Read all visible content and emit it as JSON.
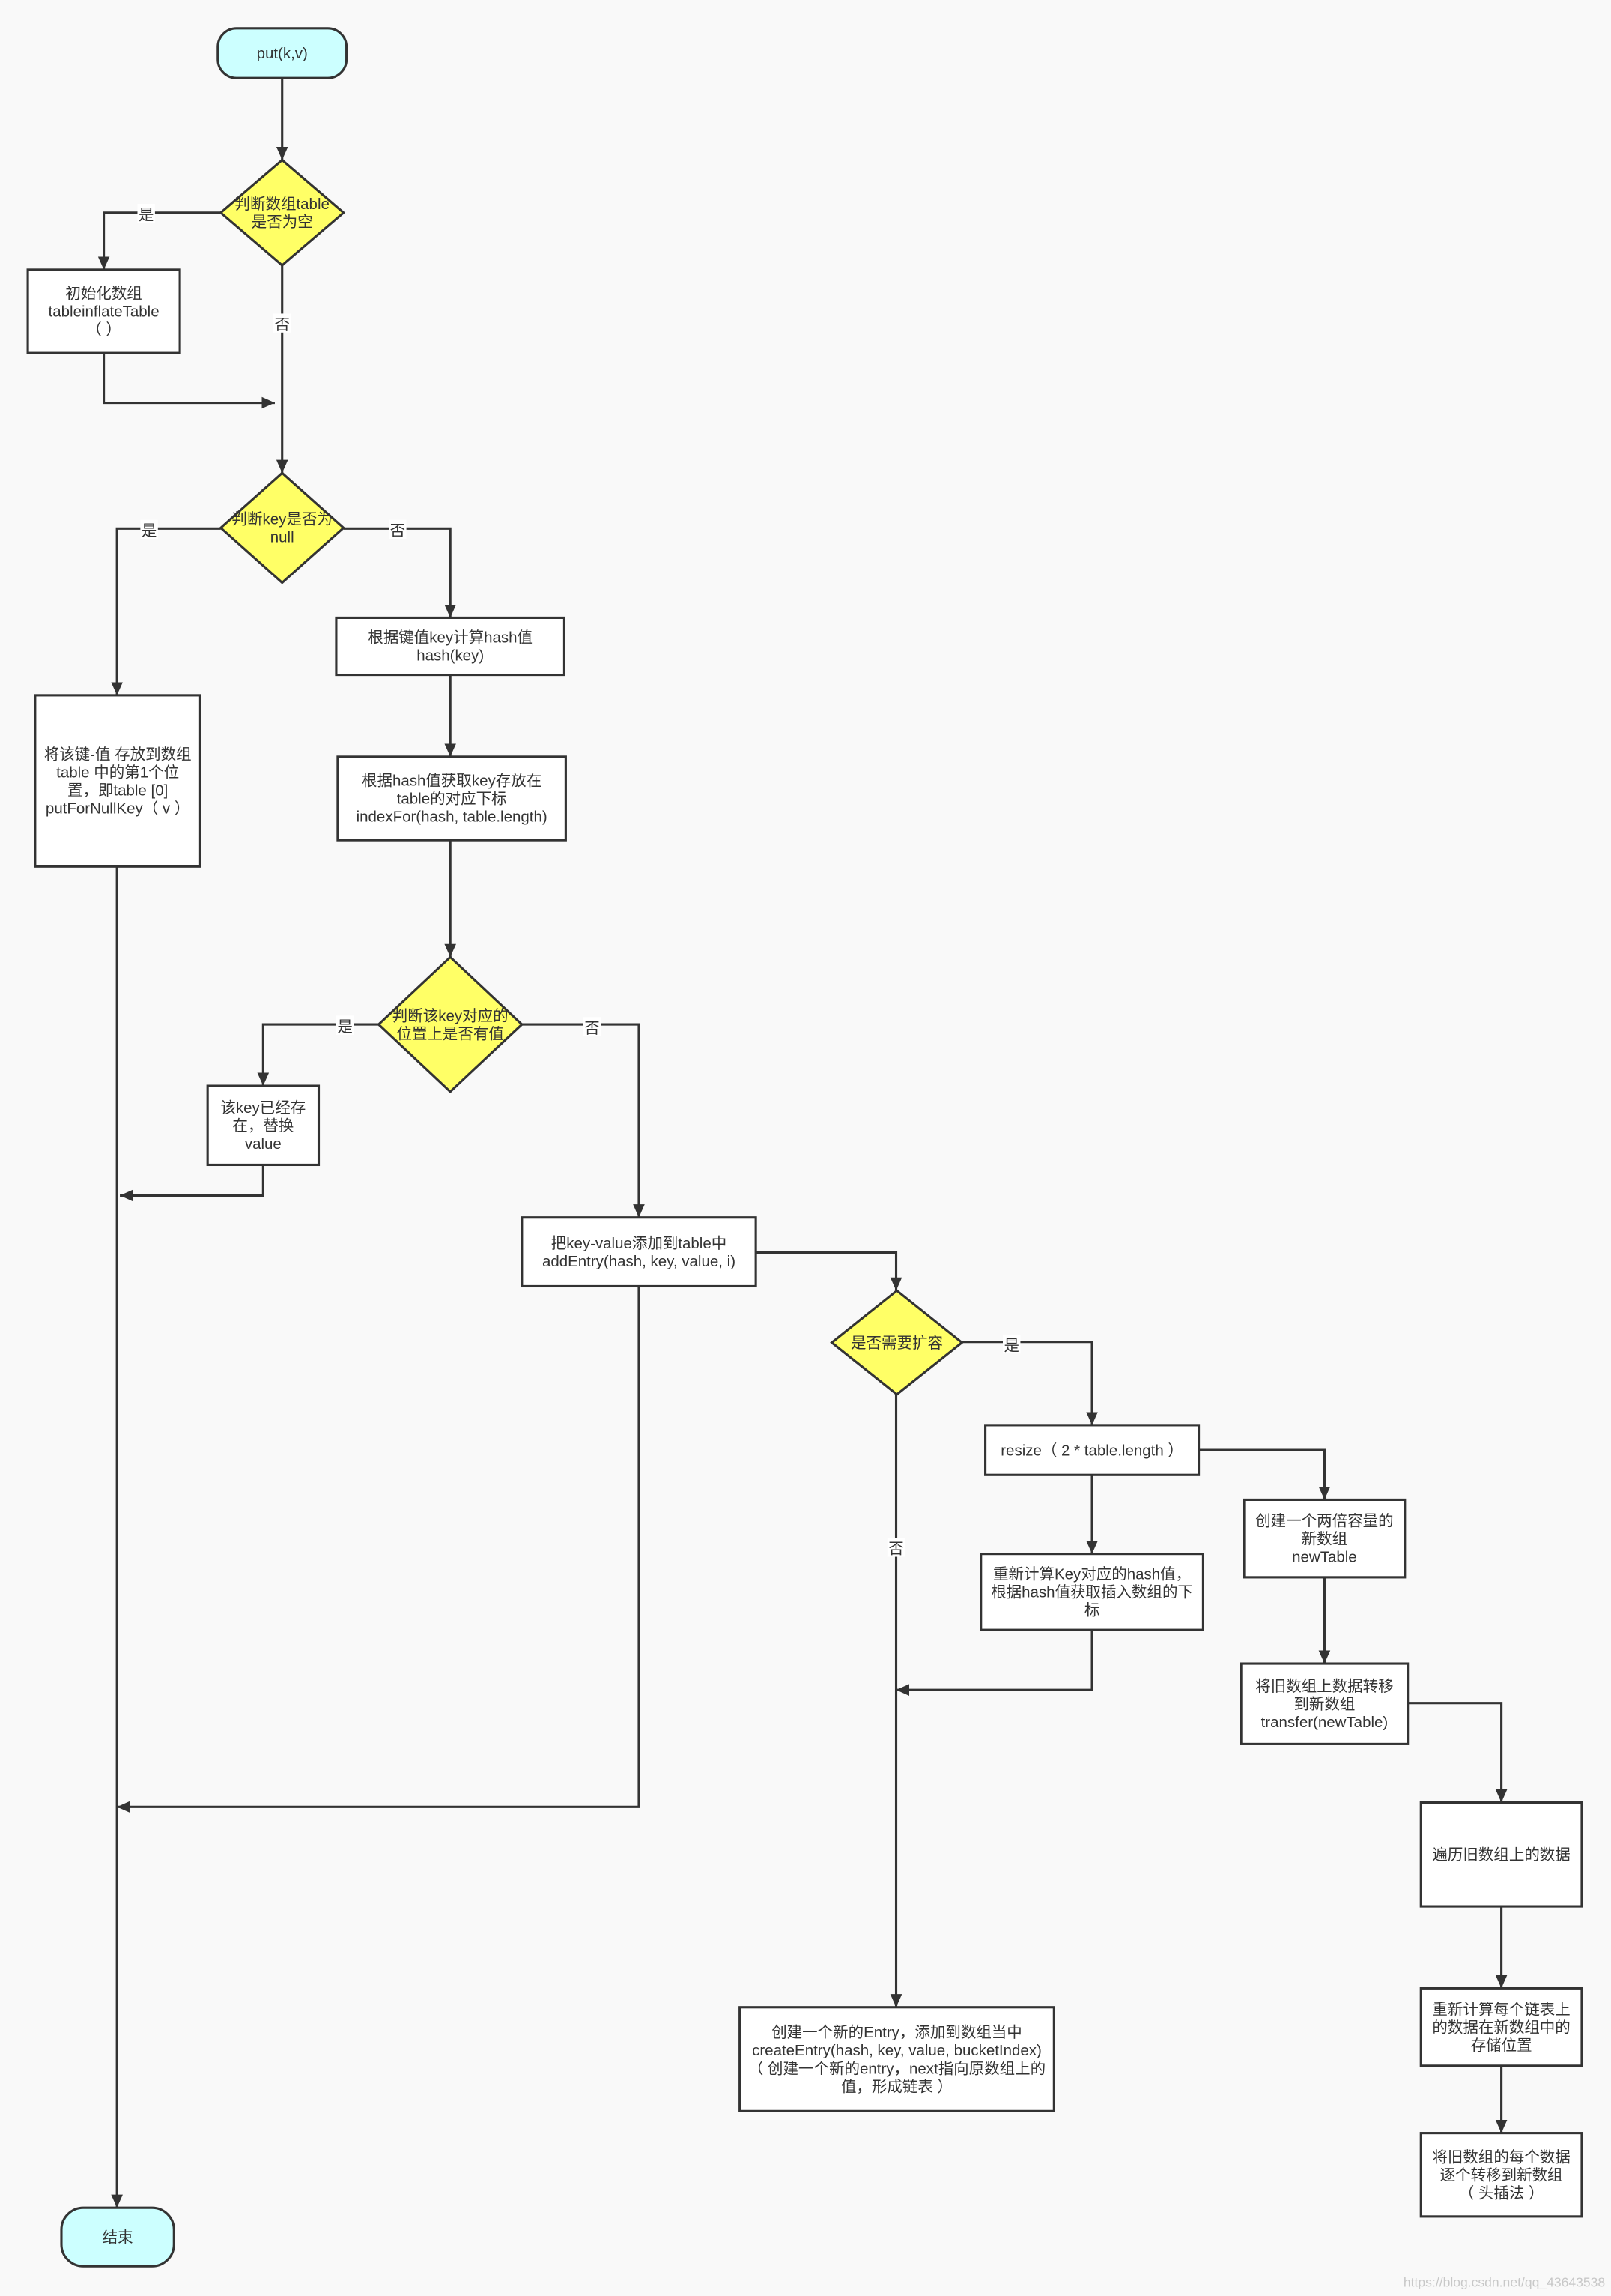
{
  "colors": {
    "background": "#f9f9f9",
    "terminal": "#ccffff",
    "decision": "#ffff66",
    "process": "#ffffff",
    "stroke": "#333333"
  },
  "nodes": {
    "start": {
      "lines": [
        "put(k,v)"
      ]
    },
    "d_table_empty": {
      "lines": [
        "判断数组table",
        "是否为空"
      ]
    },
    "init_table": {
      "lines": [
        "初始化数组",
        "tableinflateTable",
        "（ ）"
      ]
    },
    "d_key_null": {
      "lines": [
        "判断key是否为",
        "null"
      ]
    },
    "calc_hash": {
      "lines": [
        "根据键值key计算hash值",
        "hash(key)"
      ]
    },
    "index_for": {
      "lines": [
        "根据hash值获取key存放在",
        "table的对应下标",
        "indexFor(hash, table.length)"
      ]
    },
    "put_null_key": {
      "lines": [
        "将该键-值 存放到数组",
        "table 中的第1个位",
        "置，即table [0]",
        "putForNullKey（ v ）"
      ]
    },
    "d_has_value": {
      "lines": [
        "判断该key对应的",
        "位置上是否有值"
      ]
    },
    "replace_value": {
      "lines": [
        "该key已经存",
        "在，替换",
        "value"
      ]
    },
    "add_entry": {
      "lines": [
        "把key-value添加到table中",
        "addEntry(hash, key, value, i)"
      ]
    },
    "d_resize": {
      "lines": [
        "是否需要扩容"
      ]
    },
    "resize": {
      "lines": [
        "resize（ 2 * table.length ）"
      ]
    },
    "rehash": {
      "lines": [
        "重新计算Key对应的hash值，",
        "根据hash值获取插入数组的下",
        "标"
      ]
    },
    "new_table": {
      "lines": [
        "创建一个两倍容量的",
        "新数组",
        "newTable"
      ]
    },
    "transfer": {
      "lines": [
        "将旧数组上数据转移",
        "到新数组",
        "transfer(newTable)"
      ]
    },
    "iterate_old": {
      "lines": [
        "遍历旧数组上的数据"
      ]
    },
    "recompute_pos": {
      "lines": [
        "重新计算每个链表上",
        "的数据在新数组中的",
        "存储位置"
      ]
    },
    "move_entries": {
      "lines": [
        "将旧数组的每个数据",
        "逐个转移到新数组",
        "（ 头插法 ）"
      ]
    },
    "create_entry": {
      "lines": [
        "创建一个新的Entry，添加到数组当中",
        "createEntry(hash, key, value, bucketIndex)",
        "（ 创建一个新的entry，next指向原数组上的",
        "值，形成链表 ）"
      ]
    },
    "end": {
      "lines": [
        "结束"
      ]
    }
  },
  "edge_labels": {
    "table_empty_yes": "是",
    "table_empty_no": "否",
    "key_null_yes": "是",
    "key_null_no": "否",
    "has_value_yes": "是",
    "has_value_no": "否",
    "resize_yes": "是",
    "resize_no": "否"
  },
  "watermark": "https://blog.csdn.net/qq_43643538"
}
